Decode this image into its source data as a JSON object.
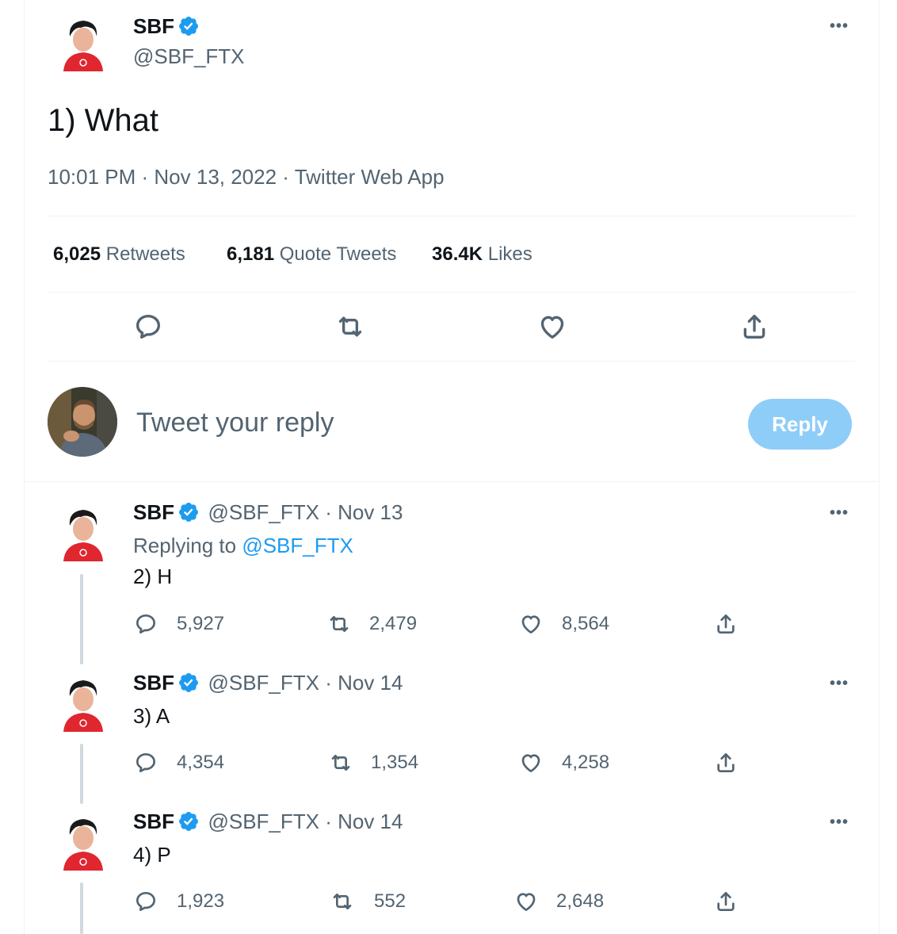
{
  "main_tweet": {
    "author_name": "SBF",
    "author_handle": "@SBF_FTX",
    "text": "1) What",
    "timestamp": "10:01 PM · Nov 13, 2022 · Twitter Web App",
    "stats": {
      "retweets_count": "6,025",
      "retweets_label": "Retweets",
      "quotes_count": "6,181",
      "quotes_label": "Quote Tweets",
      "likes_count": "36.4K",
      "likes_label": "Likes"
    }
  },
  "composer": {
    "placeholder": "Tweet your reply",
    "reply_label": "Reply"
  },
  "replies": [
    {
      "author_name": "SBF",
      "handle_date": "@SBF_FTX · Nov 13",
      "replying_prefix": "Replying to ",
      "replying_handle": "@SBF_FTX",
      "text": "2) H",
      "replies": "5,927",
      "retweets": "2,479",
      "likes": "8,564"
    },
    {
      "author_name": "SBF",
      "handle_date": "@SBF_FTX · Nov 14",
      "text": "3) A",
      "replies": "4,354",
      "retweets": "1,354",
      "likes": "4,258"
    },
    {
      "author_name": "SBF",
      "handle_date": "@SBF_FTX · Nov 14",
      "text": "4) P",
      "replies": "1,923",
      "retweets": "552",
      "likes": "2,648"
    }
  ],
  "colors": {
    "accent": "#1d9bf0",
    "reply_button_disabled": "#8ecdf8",
    "secondary_text": "#536471",
    "divider": "#eff3f4",
    "avatar_shirt": "#e0262f"
  },
  "icons": [
    "verified-badge-icon",
    "more-icon",
    "reply-icon",
    "retweet-icon",
    "like-icon",
    "share-icon"
  ]
}
